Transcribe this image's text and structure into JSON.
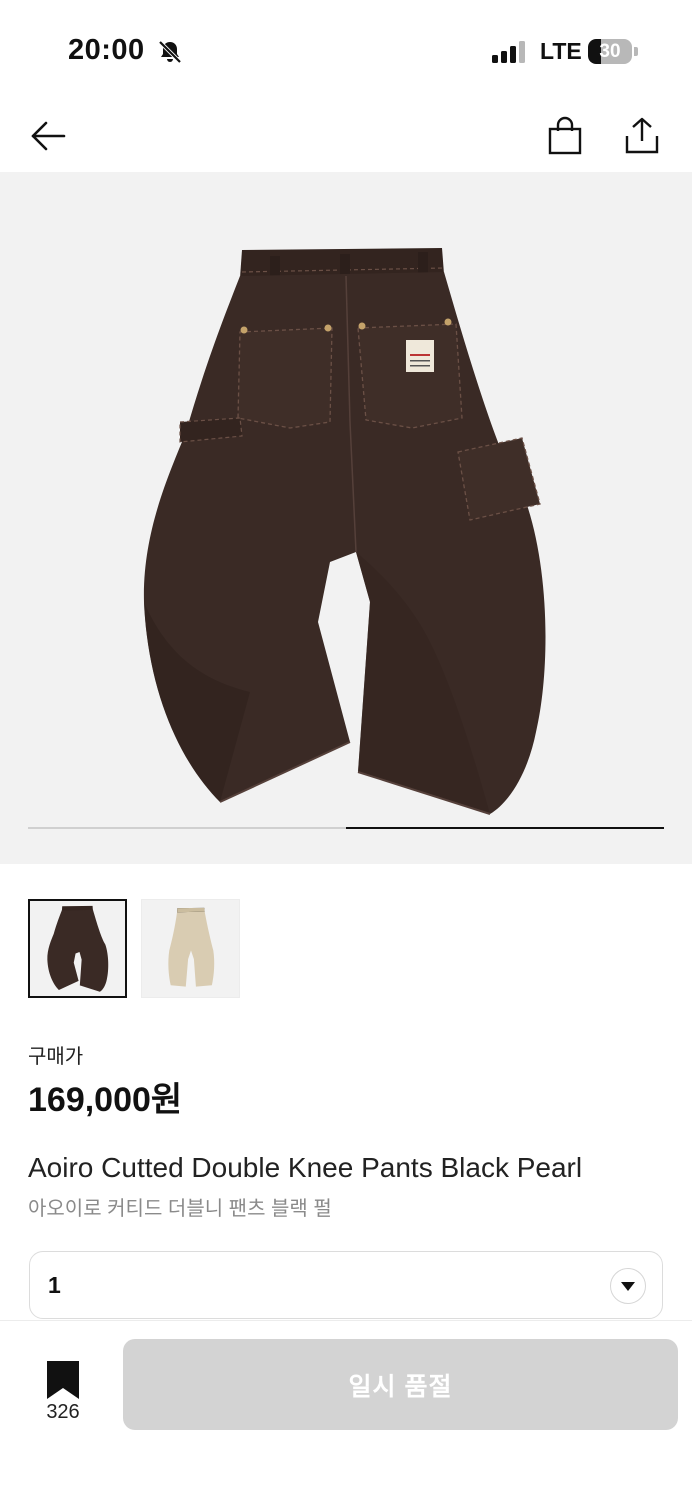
{
  "status_bar": {
    "time": "20:00",
    "network": "LTE",
    "battery_level": "30",
    "battery_fraction": 0.3
  },
  "nav": {
    "back_icon": "arrow-left-icon",
    "bag_icon": "shopping-bag-icon",
    "share_icon": "share-icon"
  },
  "gallery": {
    "image_count": 2,
    "active_index": 2
  },
  "thumbnails": [
    {
      "icon": "pants-thumbnail-dark",
      "selected": true
    },
    {
      "icon": "pants-thumbnail-beige",
      "selected": false
    }
  ],
  "price": {
    "label": "구매가",
    "value": "169,000원"
  },
  "product": {
    "name_en": "Aoiro Cutted Double Knee Pants Black Pearl",
    "name_ko": "아오이로 커티드 더블니 팬츠 블랙 펄"
  },
  "quantity": {
    "value": "1",
    "icon": "chevron-down-icon"
  },
  "bottom_bar": {
    "bookmark_icon": "bookmark-icon",
    "bookmark_count": "326",
    "cta_label": "일시 품절"
  },
  "colors": {
    "cta_disabled": "#d3d3d3",
    "gallery_bg": "#f2f2f2",
    "pants_dark": "#3a2a25",
    "pants_beige": "#d9ccb2"
  }
}
